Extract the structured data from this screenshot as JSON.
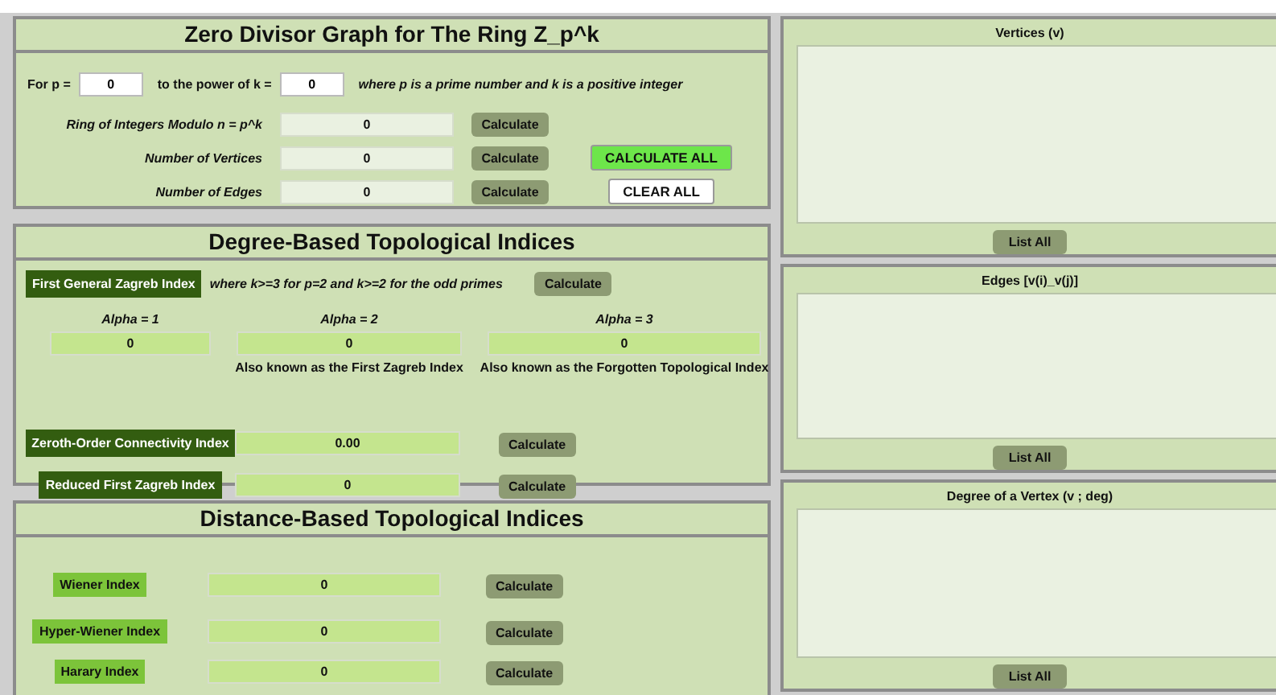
{
  "main": {
    "title": "Zero Divisor Graph for The Ring Z_p^k",
    "p_label": "For p =",
    "p_value": "0",
    "k_label": "to the power of k =",
    "k_value": "0",
    "note": "where p is a prime number and k is a positive integer",
    "rows": [
      {
        "label": "Ring of Integers Modulo n = p^k",
        "value": "0",
        "button": "Calculate"
      },
      {
        "label": "Number of Vertices",
        "value": "0",
        "button": "Calculate"
      },
      {
        "label": "Number of Edges",
        "value": "0",
        "button": "Calculate"
      }
    ],
    "calculate_all": "CALCULATE ALL",
    "clear_all": "CLEAR ALL"
  },
  "degree": {
    "title": "Degree-Based Topological Indices",
    "zagreb": {
      "label": "First General Zagreb Index",
      "note": "where k>=3 for p=2 and k>=2 for the odd primes",
      "button": "Calculate",
      "alphas": [
        {
          "label": "Alpha = 1",
          "value": "0"
        },
        {
          "label": "Alpha = 2",
          "value": "0",
          "caption": "Also known as the First Zagreb Index"
        },
        {
          "label": "Alpha = 3",
          "value": "0",
          "caption": "Also known as the Forgotten Topological Index"
        }
      ]
    },
    "rows": [
      {
        "label": "Zeroth-Order Connectivity Index",
        "value": "0.00",
        "button": "Calculate"
      },
      {
        "label": "Reduced First Zagreb Index",
        "value": "0",
        "button": "Calculate"
      }
    ]
  },
  "distance": {
    "title": "Distance-Based Topological Indices",
    "rows": [
      {
        "label": "Wiener Index",
        "value": "0",
        "button": "Calculate"
      },
      {
        "label": "Hyper-Wiener Index",
        "value": "0",
        "button": "Calculate"
      },
      {
        "label": "Harary Index",
        "value": "0",
        "button": "Calculate"
      }
    ]
  },
  "lists": [
    {
      "title": "Vertices (v)",
      "button": "List All"
    },
    {
      "title": "Edges [v(i)_v(j)]",
      "button": "List All"
    },
    {
      "title": "Degree of a Vertex (v ; deg)",
      "button": "List All"
    }
  ]
}
